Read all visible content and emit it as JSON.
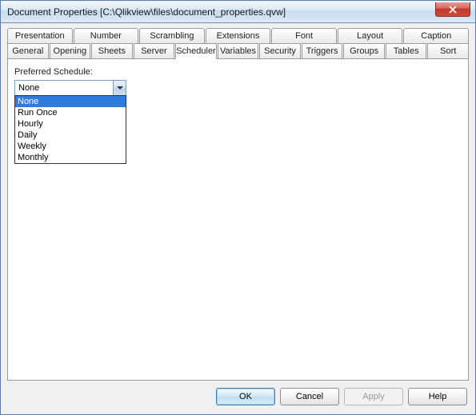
{
  "window": {
    "title": "Document Properties [C:\\Qlikview\\files\\document_properties.qvw]"
  },
  "tabs": {
    "row1": [
      {
        "label": "Presentation"
      },
      {
        "label": "Number"
      },
      {
        "label": "Scrambling"
      },
      {
        "label": "Extensions"
      },
      {
        "label": "Font"
      },
      {
        "label": "Layout"
      },
      {
        "label": "Caption"
      }
    ],
    "row2": [
      {
        "label": "General"
      },
      {
        "label": "Opening"
      },
      {
        "label": "Sheets"
      },
      {
        "label": "Server"
      },
      {
        "label": "Scheduler",
        "active": true
      },
      {
        "label": "Variables"
      },
      {
        "label": "Security"
      },
      {
        "label": "Triggers"
      },
      {
        "label": "Groups"
      },
      {
        "label": "Tables"
      },
      {
        "label": "Sort"
      }
    ]
  },
  "panel": {
    "schedule_label": "Preferred Schedule:",
    "combo_value": "None",
    "options": [
      {
        "label": "None",
        "selected": true
      },
      {
        "label": "Run Once"
      },
      {
        "label": "Hourly"
      },
      {
        "label": "Daily"
      },
      {
        "label": "Weekly"
      },
      {
        "label": "Monthly"
      }
    ]
  },
  "buttons": {
    "ok": "OK",
    "cancel": "Cancel",
    "apply": "Apply",
    "help": "Help"
  }
}
